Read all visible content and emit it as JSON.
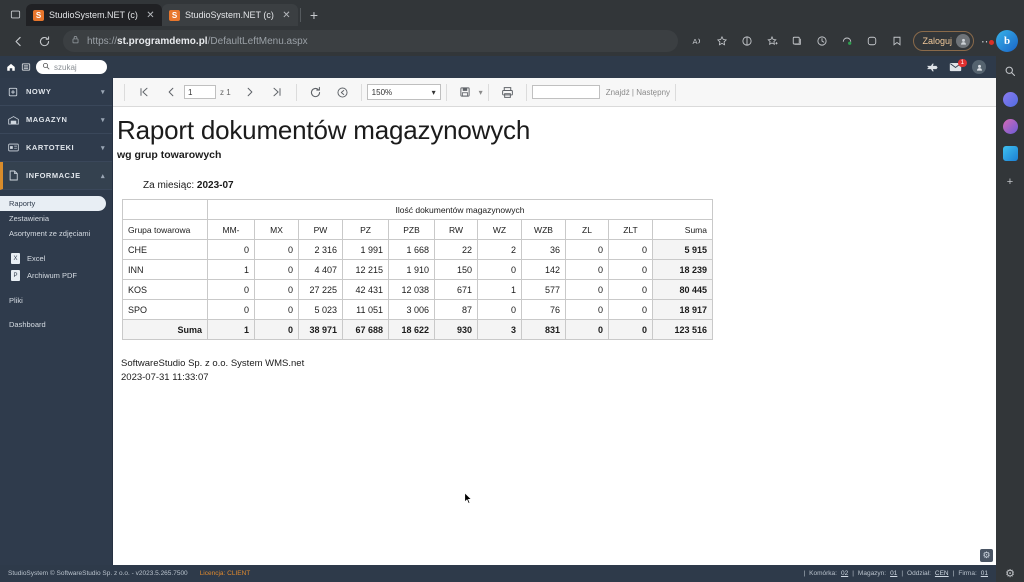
{
  "browser": {
    "tabs": [
      {
        "title": "StudioSystem.NET (c) SoftwareS",
        "favicon": "S",
        "active": true
      },
      {
        "title": "StudioSystem.NET (c) SoftwareS",
        "favicon": "S",
        "active": false
      }
    ],
    "new_tab_label": "+",
    "address": {
      "scheme": "https://",
      "host": "st.programdemo.pl",
      "path": "/DefaultLeftMenu.aspx"
    },
    "signin_label": "Zaloguj",
    "icons": {
      "tab_search": "tab-search-icon",
      "back": "back-arrow-icon",
      "refresh": "refresh-icon",
      "lock": "lock-icon",
      "read_aloud": "read-aloud-icon",
      "favorite": "star-icon",
      "split": "split-screen-icon",
      "collections": "collections-icon",
      "history": "history-icon",
      "browser_essentials": "browser-essentials-icon",
      "extensions": "extensions-icon",
      "favorites_bar": "favorites-icon",
      "settings_more": "more-options-icon",
      "copilot": "copilot-icon"
    }
  },
  "app_top": {
    "home_icon": "home-icon",
    "menu_icon": "hamburger-menu-icon",
    "search_placeholder": "szukaj",
    "notifications_count": "1"
  },
  "sidebar": {
    "groups": [
      {
        "label": "NOWY",
        "icon": "plus-box-icon",
        "open": false,
        "carat": "▾"
      },
      {
        "label": "MAGAZYN",
        "icon": "warehouse-icon",
        "open": false,
        "carat": "▾"
      },
      {
        "label": "KARTOTEKI",
        "icon": "card-file-icon",
        "open": false,
        "carat": "▾"
      },
      {
        "label": "INFORMACJE",
        "icon": "document-icon",
        "open": true,
        "carat": "▴"
      }
    ],
    "sub_items": [
      {
        "label": "Raporty",
        "active": true
      },
      {
        "label": "Zestawienia",
        "active": false
      },
      {
        "label": "Asortyment ze zdjęciami",
        "active": false
      }
    ],
    "file_items": [
      {
        "label": "Excel",
        "icon": "excel-file-icon"
      },
      {
        "label": "Archiwum PDF",
        "icon": "pdf-file-icon"
      }
    ],
    "tail_items": [
      {
        "label": "Pliki"
      },
      {
        "label": "Dashboard"
      }
    ]
  },
  "report_toolbar": {
    "first_page": "⏮",
    "prev_page": "‹",
    "page_value": "1",
    "page_of": "z 1",
    "next_page": "›",
    "last_page": "⏭",
    "refresh": "⟳",
    "back_to_parent": "⊙",
    "zoom_value": "150%",
    "zoom_caret": "▾",
    "export_icon": "save-disk-icon",
    "export_caret": "▾",
    "print_icon": "printer-icon",
    "find_value": "",
    "find_label": "Znajdź | Następny"
  },
  "report": {
    "title": "Raport dokumentów magazynowych",
    "subtitle": "wg grup towarowych",
    "month_label": "Za miesiąc:",
    "month_value": "2023-07",
    "footer_company": "SoftwareStudio Sp. z o.o. System WMS.net",
    "footer_timestamp": "2023-07-31 11:33:07"
  },
  "table_data": {
    "group_header": "Ilość dokumentów magazynowych",
    "columns": [
      "Grupa towarowa",
      "MM-",
      "MX",
      "PW",
      "PZ",
      "PZB",
      "RW",
      "WZ",
      "WZB",
      "ZL",
      "ZLT",
      "Suma"
    ],
    "rows": [
      {
        "group": "CHE",
        "values": [
          "0",
          "0",
          "2 316",
          "1 991",
          "1 668",
          "22",
          "2",
          "36",
          "0",
          "0"
        ],
        "sum": "5 915"
      },
      {
        "group": "INN",
        "values": [
          "1",
          "0",
          "4 407",
          "12 215",
          "1 910",
          "150",
          "0",
          "142",
          "0",
          "0"
        ],
        "sum": "18 239"
      },
      {
        "group": "KOS",
        "values": [
          "0",
          "0",
          "27 225",
          "42 431",
          "12 038",
          "671",
          "1",
          "577",
          "0",
          "0"
        ],
        "sum": "80 445"
      },
      {
        "group": "SPO",
        "values": [
          "0",
          "0",
          "5 023",
          "11 051",
          "3 006",
          "87",
          "0",
          "76",
          "0",
          "0"
        ],
        "sum": "18 917"
      }
    ],
    "total_row": {
      "label": "Suma",
      "values": [
        "1",
        "0",
        "38 971",
        "67 688",
        "18 622",
        "930",
        "3",
        "831",
        "0",
        "0"
      ],
      "sum": "123 516"
    }
  },
  "app_footer": {
    "copyright": "StudioSystem © SoftwareStudio Sp. z o.o. - v2023.5.265.7500",
    "license": "Licencja: CLIENT",
    "cell_label": "Komórka:",
    "cell_value": "02",
    "warehouse_label": "Magazyn:",
    "warehouse_value": "01",
    "branch_label": "Oddział:",
    "branch_value": "CEN",
    "company_label": "Firma:",
    "company_value": "01"
  },
  "colors": {
    "sidebar_bg": "#2f3b4c",
    "accent_orange": "#d98c2b",
    "badge_red": "#e03030",
    "chrome_bg": "#323639"
  }
}
